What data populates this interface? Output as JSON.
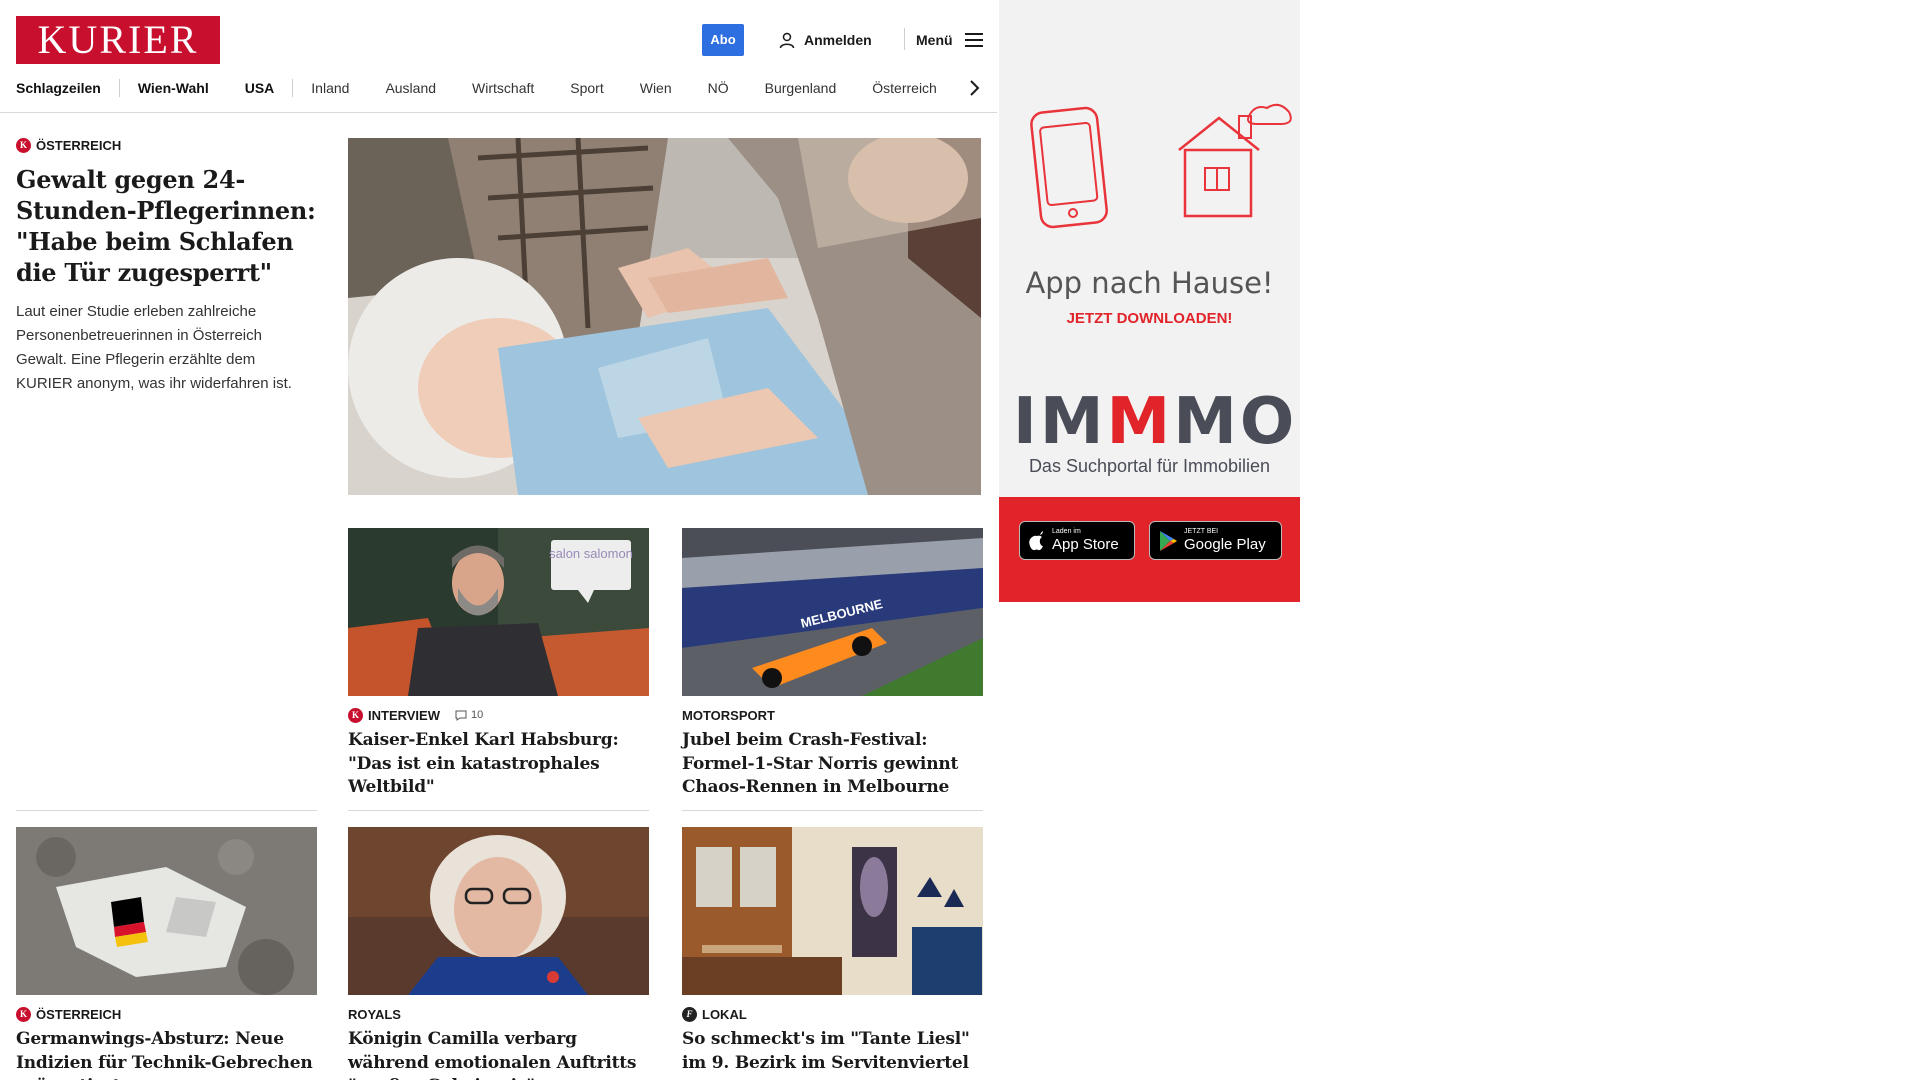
{
  "header": {
    "logo": "KURIER",
    "abo": "Abo",
    "login": "Anmelden",
    "menu": "Menü"
  },
  "nav": {
    "items": [
      "Schlagzeilen",
      "Wien-Wahl",
      "USA",
      "Inland",
      "Ausland",
      "Wirtschaft",
      "Sport",
      "Wien",
      "NÖ",
      "Burgenland",
      "Österreich"
    ]
  },
  "lead": {
    "kicker": "ÖSTERREICH",
    "title": "Gewalt gegen 24-Stunden-Pflegerinnen: \"Habe beim Schlafen die Tür zugesperrt\"",
    "description": "Laut einer Studie erleben zahlreiche Personenbetreuerinnen in Österreich Gewalt. Eine Pflegerin erzählte dem KURIER anonym, was ihr widerfahren ist."
  },
  "cards": [
    {
      "kicker": "INTERVIEW",
      "comments": "10",
      "title": "Kaiser-Enkel Karl Habsburg: \"Das ist ein katastrophales Weltbild\"",
      "image_label": "salon salomon"
    },
    {
      "kicker": "MOTORSPORT",
      "title": "Jubel beim Crash-Festival: Formel-1-Star Norris gewinnt Chaos-Rennen in Melbourne"
    },
    {
      "kicker": "ÖSTERREICH",
      "title": "Germanwings-Absturz: Neue Indizien für Technik-Gebrechen präsentiert"
    },
    {
      "kicker": "ROYALS",
      "title": "Königin Camilla verbarg während emotionalen Auftritts \"großes Geheimnis\""
    },
    {
      "kicker": "LOKAL",
      "title": "So schmeckt's im \"Tante Liesl\" im 9. Bezirk im Servitenviertel"
    }
  ],
  "ad": {
    "title": "App nach Hause!",
    "subtitle": "JETZT DOWNLOADEN!",
    "brand_part1": "IM",
    "brand_part2": "M",
    "brand_part3": "MO",
    "tagline": "Das Suchportal für Immobilien",
    "appstore_small": "Laden im",
    "appstore_big": "App Store",
    "googleplay_small": "JETZT BEI",
    "googleplay_big": "Google Play"
  },
  "colors": {
    "brand_red": "#c8102e",
    "abo_blue": "#2d6ee0",
    "ad_red": "#e0242a"
  }
}
